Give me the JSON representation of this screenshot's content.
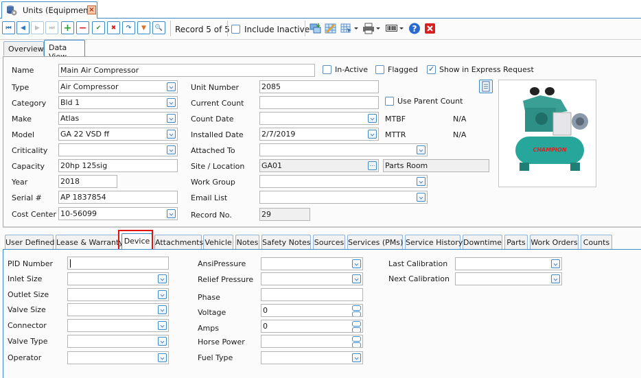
{
  "window": {
    "doc_tab_label": "Units (Equipment)",
    "doc_tab_icon": "database-gear-icon",
    "close_icon": "close-icon"
  },
  "toolbar": {
    "buttons": [
      {
        "name": "first-record-button",
        "icon": "skip-first-icon",
        "glyph": "⏮",
        "color": "#2b78c0",
        "enabled": true
      },
      {
        "name": "previous-record-button",
        "icon": "previous-icon",
        "glyph": "◀",
        "color": "#2b78c0",
        "enabled": true
      },
      {
        "name": "next-record-button",
        "icon": "next-icon",
        "glyph": "▶",
        "color": "#c0c0c0",
        "enabled": false
      },
      {
        "name": "last-record-button",
        "icon": "skip-last-icon",
        "glyph": "⏭",
        "color": "#c0c0c0",
        "enabled": false
      },
      {
        "name": "add-record-button",
        "icon": "plus-icon",
        "glyph": "+",
        "color": "#2a9a2a",
        "enabled": true
      },
      {
        "name": "delete-record-button",
        "icon": "minus-icon",
        "glyph": "−",
        "color": "#d02020",
        "enabled": true
      },
      {
        "name": "save-record-button",
        "icon": "checkmark-icon",
        "glyph": "✔",
        "color": "#2a9a2a",
        "enabled": true
      },
      {
        "name": "cancel-record-button",
        "icon": "x-icon",
        "glyph": "✖",
        "color": "#d02020",
        "enabled": true
      },
      {
        "name": "refresh-button",
        "icon": "redo-arrow-icon",
        "glyph": "↷",
        "color": "#2b78c0",
        "enabled": true
      },
      {
        "name": "filter-button",
        "icon": "filter-icon",
        "glyph": "▼",
        "color": "#e07020",
        "enabled": true
      },
      {
        "name": "search-button",
        "icon": "magnifier-icon",
        "glyph": "🔍",
        "color": "#2a8a5a",
        "enabled": true
      }
    ],
    "record_label": "Record 5 of 5",
    "include_inactive_label": "Include Inactive",
    "include_inactive_checked": false,
    "right_icons": [
      {
        "name": "copy-grid-icon",
        "has_dropdown": false
      },
      {
        "name": "grid-tools-icon",
        "has_dropdown": false
      },
      {
        "name": "grid-select-icon",
        "has_dropdown": true
      },
      {
        "name": "printer-icon",
        "has_dropdown": true
      },
      {
        "name": "barcode-icon",
        "has_dropdown": true
      },
      {
        "name": "help-icon",
        "has_dropdown": false
      },
      {
        "name": "exit-icon",
        "has_dropdown": false
      }
    ]
  },
  "view_tabs": [
    {
      "label": "Overview",
      "active": false
    },
    {
      "label": "Data View",
      "active": true
    }
  ],
  "main_form": {
    "name": {
      "label": "Name",
      "value": "Main Air Compressor"
    },
    "in_active": {
      "label": "In-Active",
      "checked": false
    },
    "flagged": {
      "label": "Flagged",
      "checked": false
    },
    "show_in_express": {
      "label": "Show in Express Request",
      "checked": true
    },
    "type": {
      "label": "Type",
      "value": "Air Compressor"
    },
    "category": {
      "label": "Category",
      "value": "Bld 1"
    },
    "make": {
      "label": "Make",
      "value": "Atlas"
    },
    "model": {
      "label": "Model",
      "value": "GA 22 VSD ff"
    },
    "criticality": {
      "label": "Criticality",
      "value": ""
    },
    "capacity": {
      "label": "Capacity",
      "value": "20hp 125sig"
    },
    "year": {
      "label": "Year",
      "value": "2018"
    },
    "serial": {
      "label": "Serial #",
      "value": "AP 1837854"
    },
    "cost_center": {
      "label": "Cost Center",
      "value": "10-56099"
    },
    "unit_number": {
      "label": "Unit Number",
      "value": "2085"
    },
    "current_count": {
      "label": "Current Count",
      "value": ""
    },
    "use_parent_count": {
      "label": "Use Parent Count",
      "checked": false
    },
    "count_date": {
      "label": "Count Date",
      "value": ""
    },
    "mtbf": {
      "label": "MTBF",
      "value": "N/A"
    },
    "installed_date": {
      "label": "Installed Date",
      "value": "2/7/2019"
    },
    "mttr": {
      "label": "MTTR",
      "value": "N/A"
    },
    "attached_to": {
      "label": "Attached To",
      "value": ""
    },
    "site_location": {
      "label": "Site / Location",
      "value": "GA01",
      "description": "Parts Room"
    },
    "work_group": {
      "label": "Work Group",
      "value": ""
    },
    "email_list": {
      "label": "Email List",
      "value": ""
    },
    "record_no": {
      "label": "Record No.",
      "value": "29"
    },
    "photo": {
      "alt": "Air compressor photo",
      "brand_text": "CHAMPION"
    }
  },
  "detail_tabs": [
    {
      "label": "User Defined",
      "active": false
    },
    {
      "label": "Lease & Warranty",
      "active": false
    },
    {
      "label": "Device",
      "active": true
    },
    {
      "label": "Attachments",
      "active": false
    },
    {
      "label": "Vehicle",
      "active": false
    },
    {
      "label": "Notes",
      "active": false
    },
    {
      "label": "Safety Notes",
      "active": false
    },
    {
      "label": "Sources",
      "active": false
    },
    {
      "label": "Services (PMs)",
      "active": false
    },
    {
      "label": "Service History",
      "active": false
    },
    {
      "label": "Downtime",
      "active": false
    },
    {
      "label": "Parts",
      "active": false
    },
    {
      "label": "Work Orders",
      "active": false
    },
    {
      "label": "Counts",
      "active": false
    }
  ],
  "device_form": {
    "pid_number": {
      "label": "PID Number",
      "value": ""
    },
    "inlet_size": {
      "label": "Inlet Size",
      "value": ""
    },
    "outlet_size": {
      "label": "Outlet Size",
      "value": ""
    },
    "valve_size": {
      "label": "Valve Size",
      "value": ""
    },
    "connector": {
      "label": "Connector",
      "value": ""
    },
    "valve_type": {
      "label": "Valve Type",
      "value": ""
    },
    "operator": {
      "label": "Operator",
      "value": ""
    },
    "ansi_pressure": {
      "label": "AnsiPressure",
      "value": ""
    },
    "relief_pressure": {
      "label": "Relief Pressure",
      "value": ""
    },
    "phase": {
      "label": "Phase",
      "value": ""
    },
    "voltage": {
      "label": "Voltage",
      "value": "0"
    },
    "amps": {
      "label": "Amps",
      "value": "0"
    },
    "horse_power": {
      "label": "Horse Power",
      "value": ""
    },
    "fuel_type": {
      "label": "Fuel Type",
      "value": ""
    },
    "last_calibration": {
      "label": "Last Calibration",
      "value": ""
    },
    "next_calibration": {
      "label": "Next Calibration",
      "value": ""
    }
  }
}
